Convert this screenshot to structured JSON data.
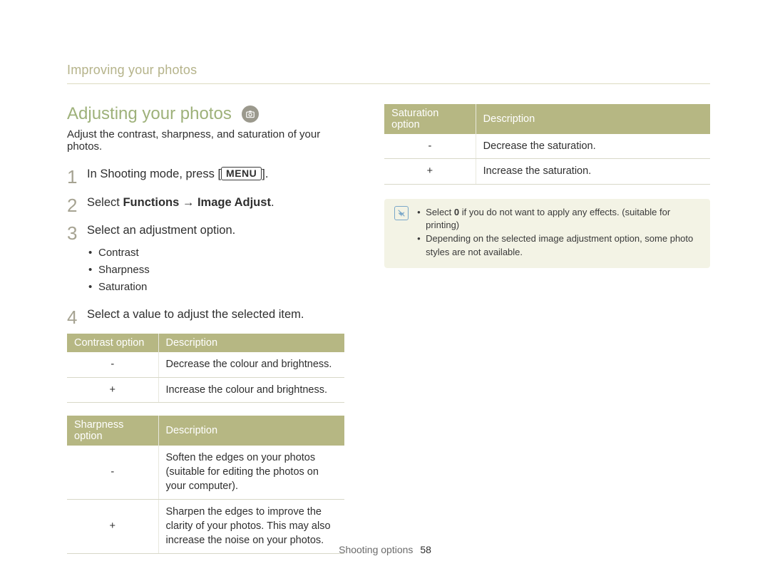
{
  "breadcrumb": "Improving your photos",
  "section_title": "Adjusting your photos",
  "intro": "Adjust the contrast, sharpness, and saturation of your photos.",
  "steps": {
    "one_pre": "In Shooting mode, press [",
    "one_menu": "MENU",
    "one_post": "].",
    "two_pre": "Select ",
    "two_bold": "Functions → Image Adjust",
    "two_post": ".",
    "three": "Select an adjustment option.",
    "three_sub": [
      "Contrast",
      "Sharpness",
      "Saturation"
    ],
    "four": "Select a value to adjust the selected item."
  },
  "tables": {
    "contrast": {
      "headers": [
        "Contrast option",
        "Description"
      ],
      "rows": [
        [
          "-",
          "Decrease the colour and brightness."
        ],
        [
          "+",
          "Increase the colour and brightness."
        ]
      ]
    },
    "sharpness": {
      "headers": [
        "Sharpness option",
        "Description"
      ],
      "rows": [
        [
          "-",
          "Soften the edges on your photos (suitable for editing the photos on your computer)."
        ],
        [
          "+",
          "Sharpen the edges to improve the clarity of your photos. This may also increase the noise on your photos."
        ]
      ]
    },
    "saturation": {
      "headers": [
        "Saturation option",
        "Description"
      ],
      "rows": [
        [
          "-",
          "Decrease the saturation."
        ],
        [
          "+",
          "Increase the saturation."
        ]
      ]
    }
  },
  "note": {
    "items": [
      {
        "pre": "Select ",
        "bold": "0",
        "post": " if you do not want to apply any effects. (suitable for printing)"
      },
      {
        "pre": "",
        "bold": "",
        "post": "Depending on the selected image adjustment option, some photo styles are not available."
      }
    ]
  },
  "footer": {
    "label": "Shooting options",
    "page": "58"
  }
}
